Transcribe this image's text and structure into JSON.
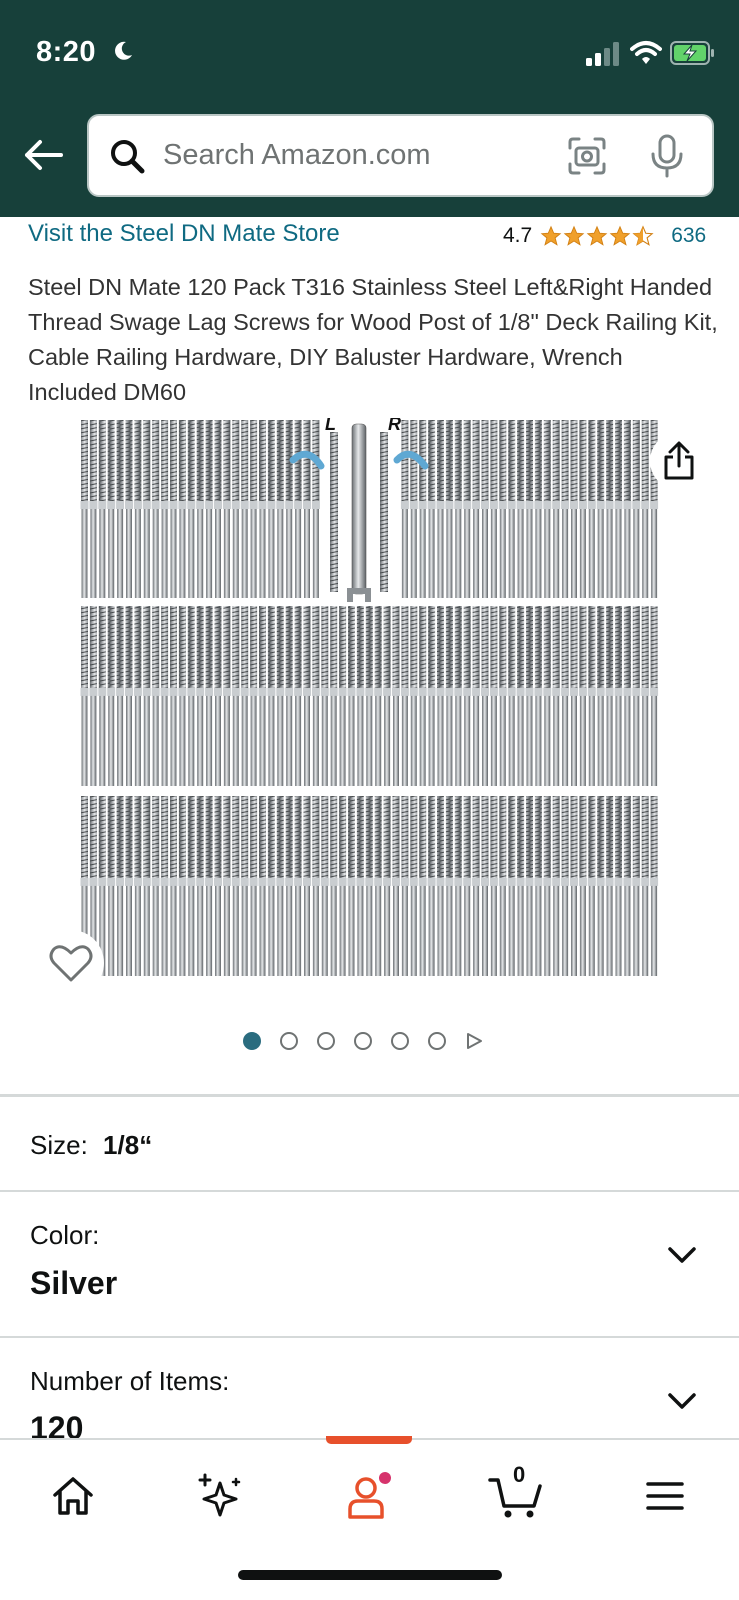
{
  "status_bar": {
    "time": "8:20"
  },
  "search": {
    "placeholder": "Search Amazon.com"
  },
  "store": {
    "link_text": "Visit the Steel DN Mate Store"
  },
  "rating": {
    "value": "4.7",
    "stars": 4.5,
    "count": "636",
    "star_color": "#f0a02b"
  },
  "product": {
    "title": "Steel DN Mate 120 Pack T316 Stainless Steel Left&Right Handed Thread Swage Lag Screws for Wood Post of 1/8\" Deck Railing Kit, Cable Railing Hardware, DIY Baluster Hardware, Wrench Included DM60",
    "image_labels": {
      "left": "L",
      "right": "R"
    }
  },
  "carousel": {
    "total_images": 6,
    "active_index": 0,
    "has_video": true
  },
  "options": {
    "size": {
      "label": "Size:",
      "value": "1/8“"
    },
    "color": {
      "label": "Color:",
      "value": "Silver"
    },
    "items": {
      "label": "Number of Items:",
      "value": "120"
    }
  },
  "bottom_nav": {
    "items": [
      "home-icon",
      "ai-sparkle-icon",
      "account-icon",
      "cart-icon",
      "menu-icon"
    ],
    "active": "account-icon",
    "cart_count": "0",
    "accent": "#e7502b"
  },
  "colors": {
    "header_bg": "#17403a",
    "link": "#0f6a82"
  }
}
